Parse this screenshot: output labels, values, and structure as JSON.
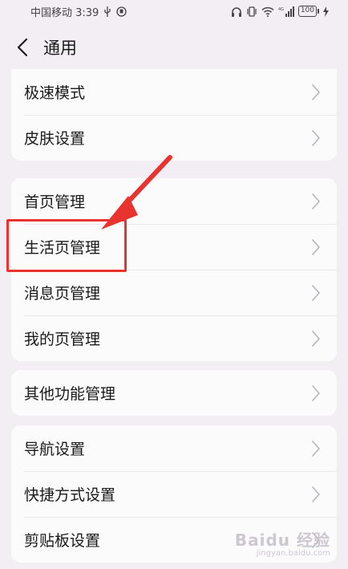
{
  "status_bar": {
    "carrier_time": "中国移动 3:39",
    "network": "4G",
    "battery": "100"
  },
  "header": {
    "title": "通用"
  },
  "groups": [
    {
      "items": [
        {
          "label": "极速模式"
        },
        {
          "label": "皮肤设置"
        }
      ]
    },
    {
      "items": [
        {
          "label": "首页管理"
        },
        {
          "label": "生活页管理"
        },
        {
          "label": "消息页管理"
        },
        {
          "label": "我的页管理"
        }
      ]
    },
    {
      "items": [
        {
          "label": "其他功能管理"
        }
      ]
    },
    {
      "items": [
        {
          "label": "导航设置"
        },
        {
          "label": "快捷方式设置"
        },
        {
          "label": "剪贴板设置"
        }
      ]
    }
  ],
  "annotation": {
    "highlight_color": "#e8332f"
  },
  "watermark": {
    "main": "Baidu 经验",
    "sub": "jingyan.baidu.com"
  }
}
